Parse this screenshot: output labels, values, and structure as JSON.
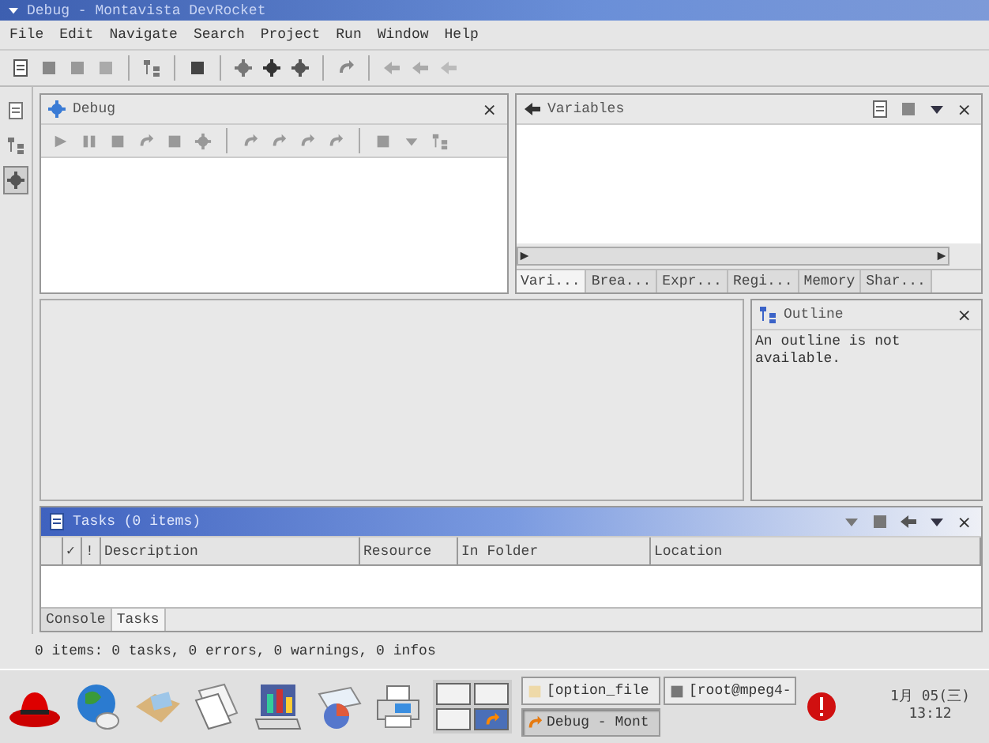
{
  "window": {
    "title": "Debug - Montavista DevRocket"
  },
  "menu": [
    "File",
    "Edit",
    "Navigate",
    "Search",
    "Project",
    "Run",
    "Window",
    "Help"
  ],
  "debug_view": {
    "title": "Debug",
    "close": "×"
  },
  "variables_view": {
    "title": "Variables",
    "close": "×",
    "tabs": [
      {
        "label": "Vari...",
        "selected": true
      },
      {
        "label": "Brea...",
        "selected": false
      },
      {
        "label": "Expr...",
        "selected": false
      },
      {
        "label": "Regi...",
        "selected": false
      },
      {
        "label": "Memory",
        "selected": false
      },
      {
        "label": "Shar...",
        "selected": false
      }
    ]
  },
  "outline_view": {
    "title": "Outline",
    "close": "×",
    "message": "An outline is not available."
  },
  "tasks_view": {
    "title": "Tasks (0 items)",
    "close": "×",
    "columns": [
      "",
      "✓",
      "!",
      "Description",
      "Resource",
      "In Folder",
      "Location"
    ],
    "tabs": [
      {
        "label": "Console",
        "selected": false
      },
      {
        "label": "Tasks",
        "selected": true
      }
    ]
  },
  "status_bar": "0 items: 0 tasks, 0 errors, 0 warnings, 0 infos",
  "taskbar": {
    "tasks": [
      {
        "label": "[option_file",
        "selected": false
      },
      {
        "label": "[root@mpeg4-",
        "selected": false
      },
      {
        "label": "Debug - Mont",
        "selected": true
      }
    ],
    "clock": {
      "date": "1月 05(三)",
      "time": "13:12"
    }
  }
}
